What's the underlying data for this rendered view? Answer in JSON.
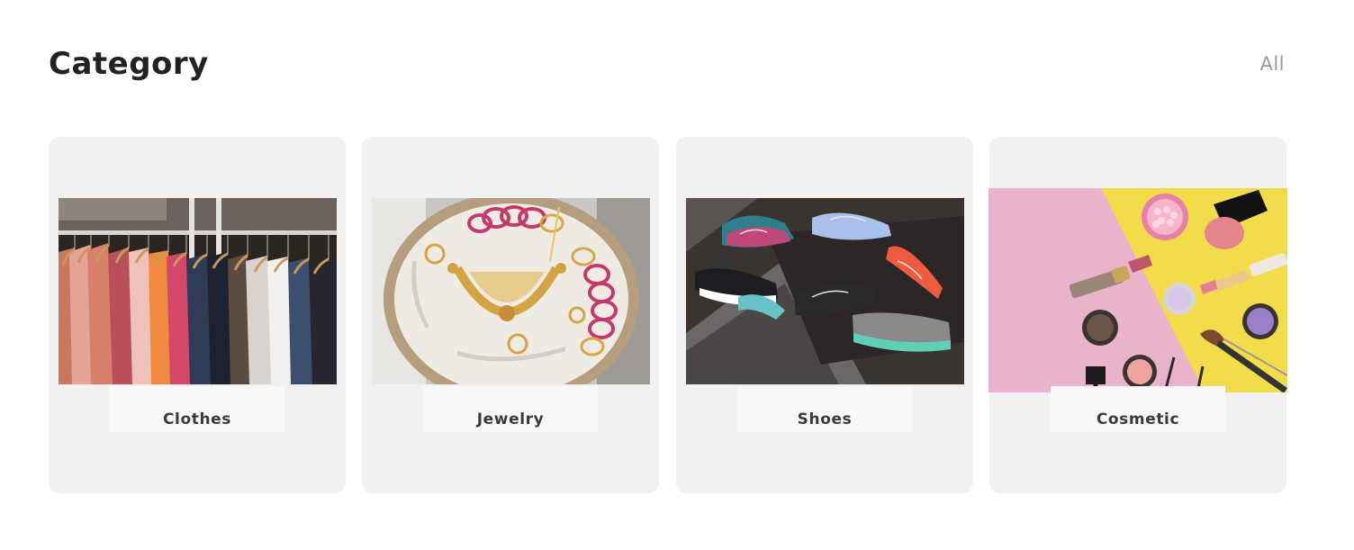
{
  "header": {
    "title": "Category",
    "view_all_label": "All"
  },
  "categories": [
    {
      "label": "Clothes",
      "image_icon": "clothes-rack-photo"
    },
    {
      "label": "Jewelry",
      "image_icon": "jewelry-tray-photo"
    },
    {
      "label": "Shoes",
      "image_icon": "sneakers-treadmill-photo"
    },
    {
      "label": "Cosmetic",
      "image_icon": "makeup-flatlay-photo"
    }
  ],
  "colors": {
    "card_bg": "#f1f1f1",
    "label_bg": "#f8f8f8",
    "title": "#222222",
    "view_all": "#9a9a9a"
  }
}
